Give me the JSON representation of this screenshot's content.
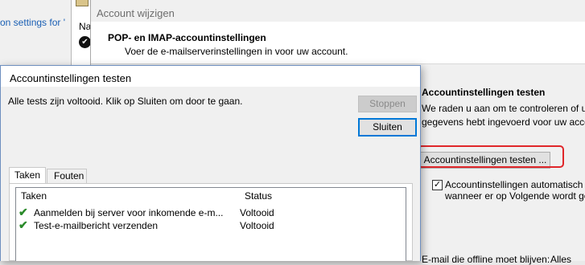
{
  "background_window": {
    "link_text": "on settings for '"
  },
  "middle_window": {
    "letter": "Na",
    "check_glyph": "✔"
  },
  "account_dialog": {
    "title": "Account wijzigen",
    "heading": "POP- en IMAP-accountinstellingen",
    "subheading": "Voer de e-mailserverinstellingen in voor uw account.",
    "section_title": "Accountinstellingen testen",
    "description_line1": "We raden u aan om te controleren of u d",
    "description_line2": "gegevens hebt ingevoerd voor uw accou",
    "test_button_label": "Accountinstellingen testen ...",
    "auto_test_checked": true,
    "auto_test_line1": "Accountinstellingen automatisch t",
    "auto_test_line2": "wanneer er op Volgende wordt ge",
    "offline_label": "E-mail die offline moet blijven:",
    "offline_value": "Alles",
    "highlight_color": "#e0262a"
  },
  "test_dialog": {
    "title": "Accountinstellingen testen",
    "status_message": "Alle tests zijn voltooid. Klik op Sluiten om door te gaan.",
    "stop_button": "Stoppen",
    "close_button": "Sluiten",
    "tabs": [
      {
        "label": "Taken",
        "active": true
      },
      {
        "label": "Fouten",
        "active": false
      }
    ],
    "columns": {
      "tasks": "Taken",
      "status": "Status"
    },
    "rows": [
      {
        "check": "✔",
        "task": "Aanmelden bij server voor inkomende e-m...",
        "status": "Voltooid"
      },
      {
        "check": "✔",
        "task": "Test-e-mailbericht verzenden",
        "status": "Voltooid"
      }
    ]
  }
}
